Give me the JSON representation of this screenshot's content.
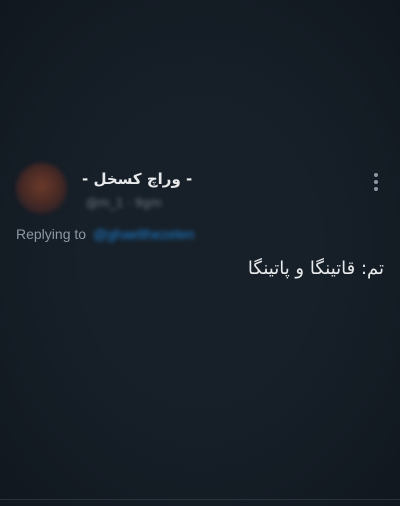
{
  "tweet": {
    "author": {
      "display_name": "- وراچ کسخل -",
      "handle_time": "@m_1 · 9gm"
    },
    "replying_to": {
      "label": "Replying to",
      "handle": "@ghaelthezelen"
    },
    "text": "تم: قاتینگا و پاتینگا",
    "icons": {
      "more": "more-vertical-icon"
    },
    "colors": {
      "background": "#172029",
      "link": "#1d7fd1",
      "secondary_text": "#8b98a5",
      "primary_text": "#e7e9ea"
    }
  }
}
